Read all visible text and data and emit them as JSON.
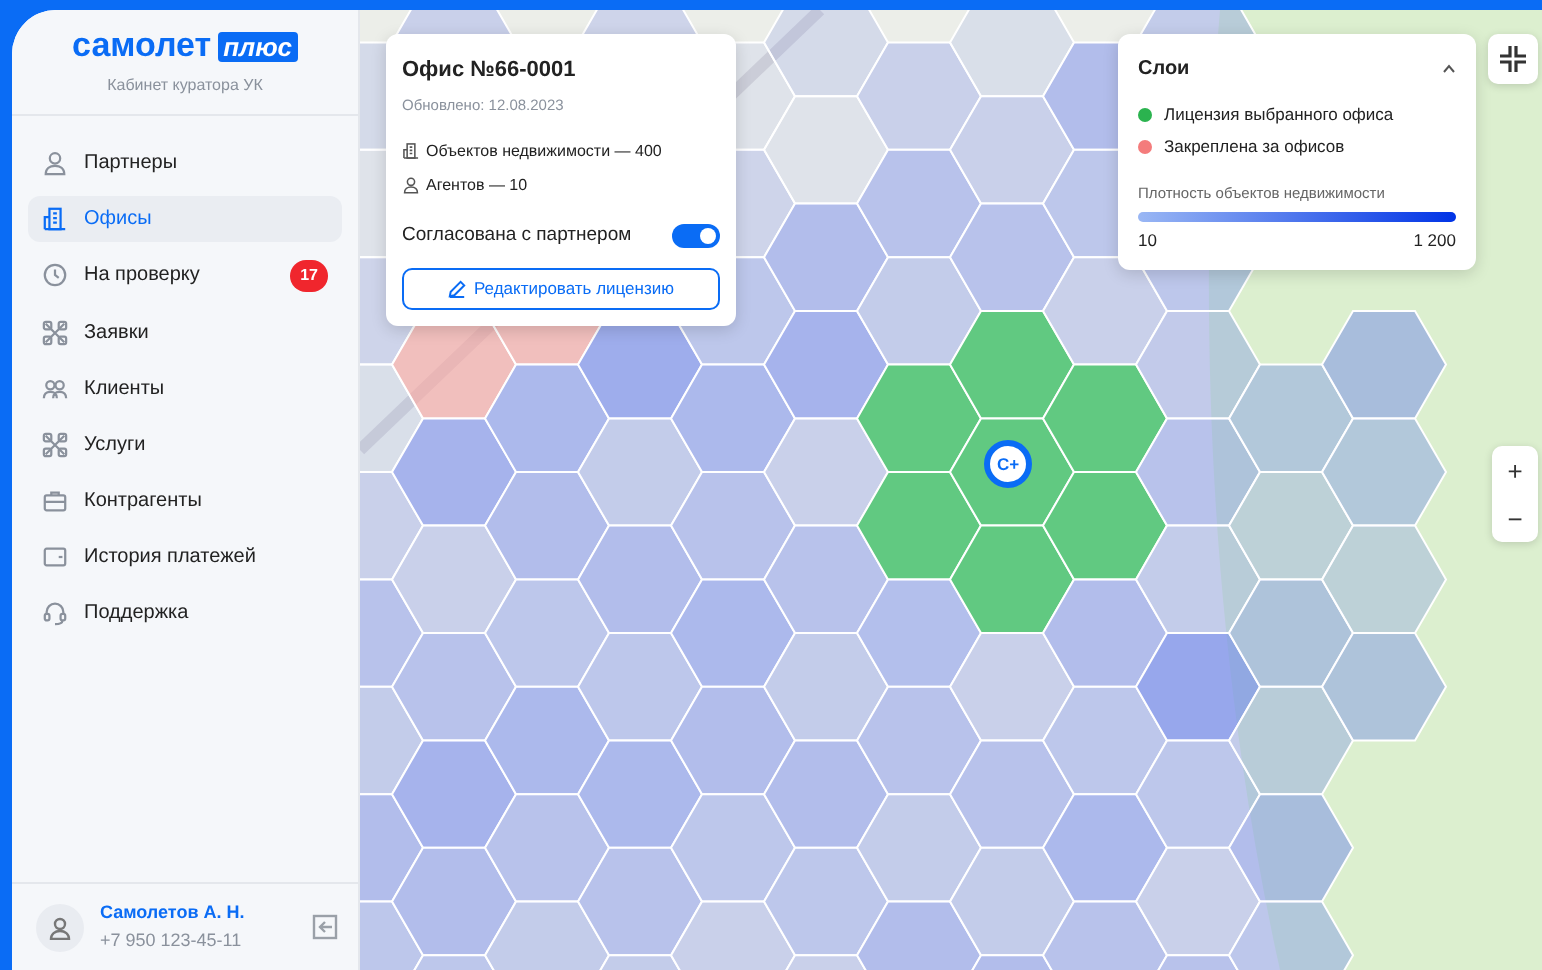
{
  "brand": {
    "logo_word": "самолет",
    "logo_badge": "плюс",
    "subtitle": "Кабинет куратора УК"
  },
  "sidebar": {
    "items": [
      {
        "label": "Партнеры",
        "kind": "user",
        "selected": false
      },
      {
        "label": "Офисы",
        "kind": "building",
        "selected": true
      },
      {
        "label": "На проверку",
        "kind": "clock",
        "selected": false,
        "badge": "17"
      },
      {
        "label": "Заявки",
        "kind": "tools",
        "selected": false
      },
      {
        "label": "Клиенты",
        "kind": "users",
        "selected": false
      },
      {
        "label": "Услуги",
        "kind": "tools",
        "selected": false
      },
      {
        "label": "Контрагенты",
        "kind": "briefcase",
        "selected": false
      },
      {
        "label": "История платежей",
        "kind": "wallet",
        "selected": false
      },
      {
        "label": "Поддержка",
        "kind": "headset",
        "selected": false
      }
    ]
  },
  "user": {
    "name": "Самолетов А. Н.",
    "phone": "+7 950 123-45-11"
  },
  "office_card": {
    "title": "Офис №66-0001",
    "updated": "Обновлено: 12.08.2023",
    "stats": [
      {
        "kind": "building",
        "text": "Объектов недвижимости — 400"
      },
      {
        "kind": "agent",
        "text": "Агентов — 10"
      }
    ],
    "toggle": {
      "label": "Согласована с партнером",
      "on": true
    },
    "button": "Редактировать лицензию"
  },
  "layers": {
    "title": "Слои",
    "expanded": true,
    "legend": [
      {
        "label": "Лицензия выбранного офиса",
        "color": "#2bb34f"
      },
      {
        "label": "Закреплена за офисов",
        "color": "#f47c7c"
      }
    ],
    "density": {
      "label": "Плотность объектов недвижимости",
      "min": "10",
      "max": "1 200"
    }
  },
  "map_controls": {
    "zoom_in": "+",
    "zoom_out": "−"
  },
  "marker": {
    "label": "С+"
  }
}
